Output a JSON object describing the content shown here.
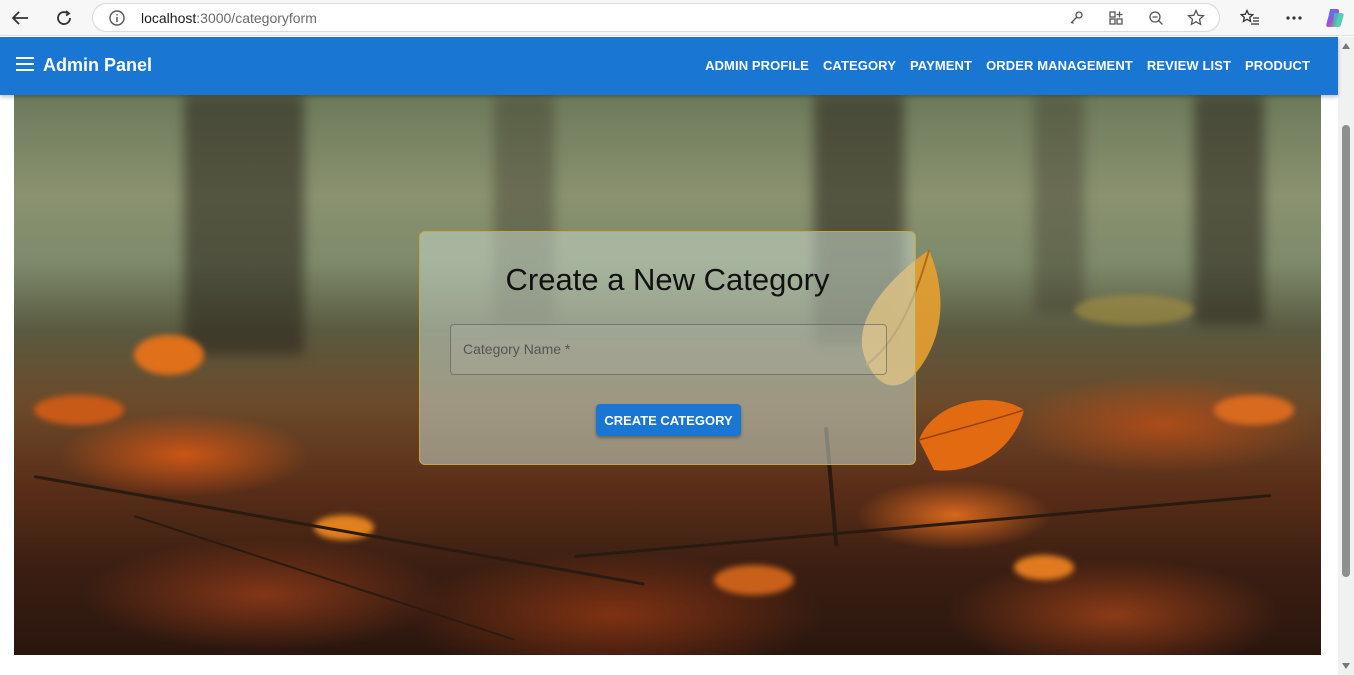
{
  "browser": {
    "url_host": "localhost",
    "url_port_path": ":3000/categoryform"
  },
  "appbar": {
    "title": "Admin Panel",
    "nav": [
      {
        "label": "ADMIN PROFILE"
      },
      {
        "label": "CATEGORY"
      },
      {
        "label": "PAYMENT"
      },
      {
        "label": "ORDER MANAGEMENT"
      },
      {
        "label": "REVIEW LIST"
      },
      {
        "label": "PRODUCT"
      }
    ]
  },
  "form": {
    "title": "Create a New Category",
    "field_label": "Category Name *",
    "submit_label": "CREATE CATEGORY"
  },
  "colors": {
    "primary": "#1976d2",
    "card_border": "#c9a640"
  }
}
